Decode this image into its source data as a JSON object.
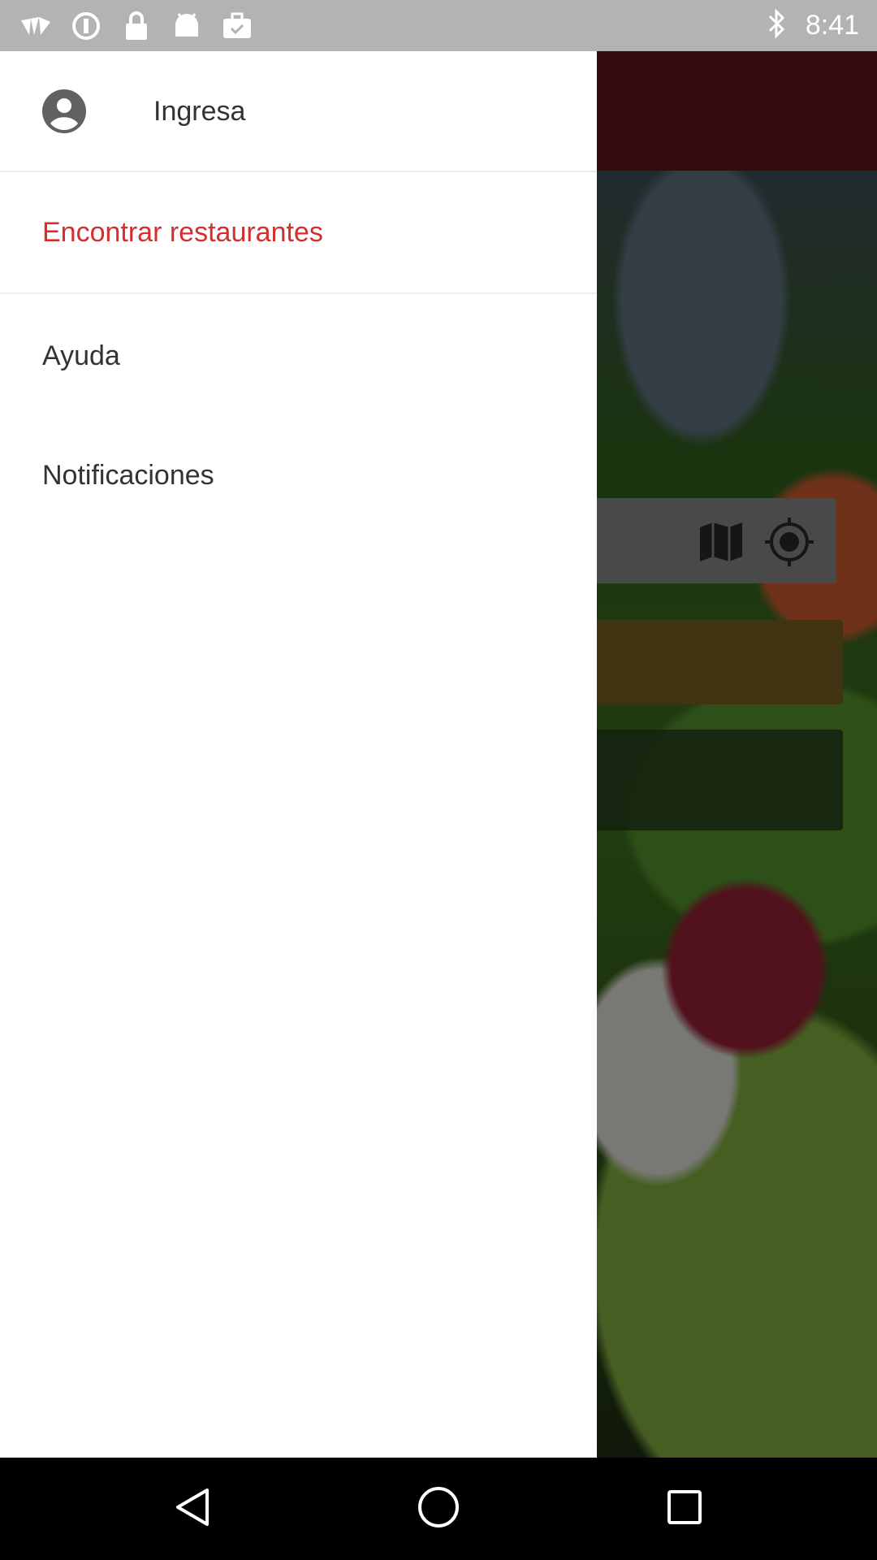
{
  "status_bar": {
    "time": "8:41",
    "left_icons": [
      "bird-notification-icon",
      "info-icon",
      "lock-icon",
      "android-icon",
      "briefcase-check-icon"
    ],
    "right_icons": [
      "bluetooth-icon"
    ]
  },
  "drawer": {
    "header": {
      "login_label": "Ingresa"
    },
    "items": [
      {
        "label": "Encontrar restaurantes",
        "selected": true
      },
      {
        "label": "Ayuda",
        "selected": false
      },
      {
        "label": "Notificaciones",
        "selected": false
      }
    ]
  },
  "colors": {
    "accent": "#d32f2f",
    "app_bar": "#5a1216",
    "drawer_bg": "#ffffff",
    "status_bar": "#b3b3b3"
  },
  "background_app": {
    "search_icons": [
      "map-icon",
      "my-location-icon"
    ]
  },
  "navigation_bar": {
    "buttons": [
      "back-icon",
      "home-icon",
      "recents-icon"
    ]
  }
}
